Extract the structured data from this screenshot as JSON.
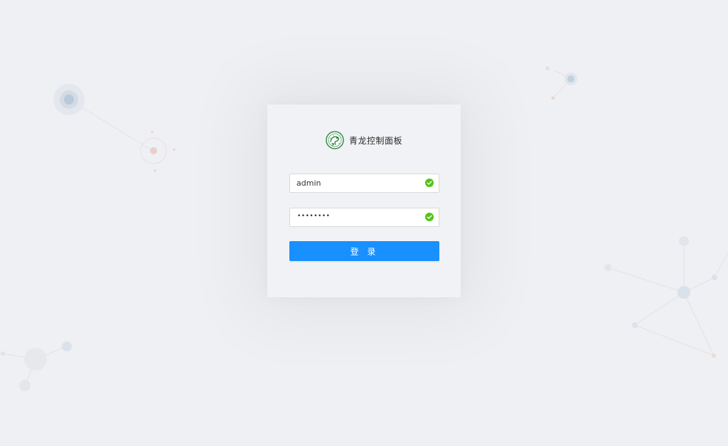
{
  "app": {
    "title": "青龙控制面板",
    "logo_icon": "qinglong-dragon-logo"
  },
  "form": {
    "username": {
      "value": "admin",
      "status": "success"
    },
    "password": {
      "masked_value": "••••••••",
      "status": "success"
    },
    "submit_label": "登 录"
  },
  "colors": {
    "primary": "#1890ff",
    "success": "#52c41a",
    "background": "#eff0f3"
  }
}
